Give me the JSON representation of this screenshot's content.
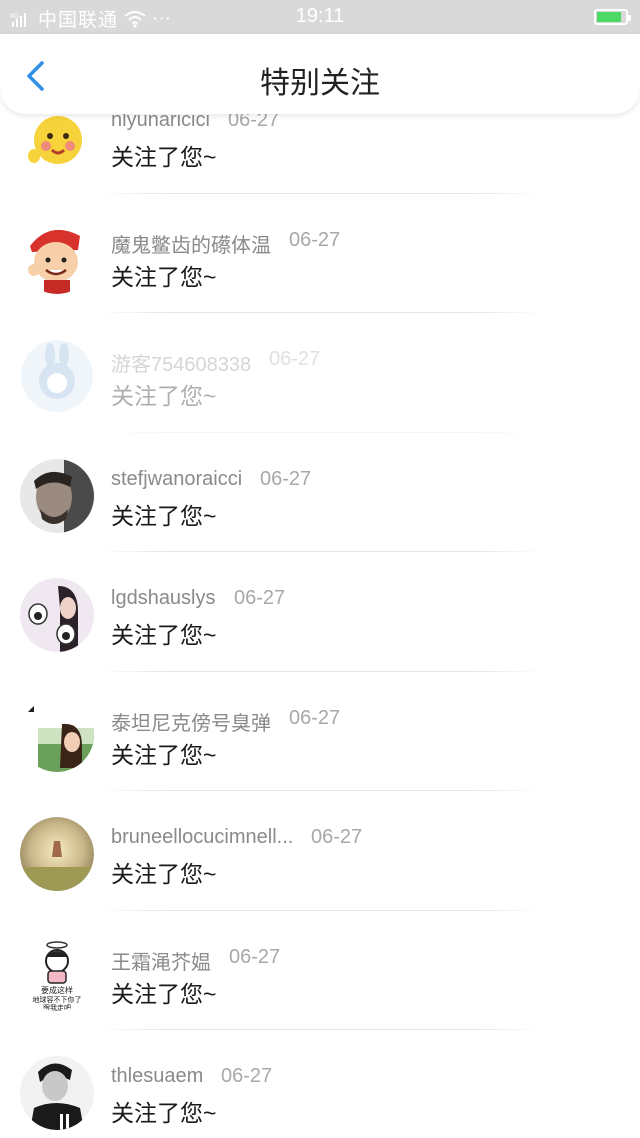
{
  "status_bar": {
    "carrier": "中国联通",
    "time": "19:11",
    "more": "···",
    "battery_level": 0.85
  },
  "header": {
    "title": "特别关注",
    "back_icon": "chevron-left-icon",
    "accent": "#2f8ee6"
  },
  "items": [
    {
      "name": "nlyunaricici",
      "date": "06-27",
      "message": "关注了您~",
      "avatar": "yellow-smiley-avatar"
    },
    {
      "name": "魔鬼鳖齿的礤体温",
      "date": "06-27",
      "message": "关注了您~",
      "avatar": "cartoon-boy-avatar"
    },
    {
      "name": "游客754608338",
      "date": "06-27",
      "message": "关注了您~",
      "avatar": "default-rabbit-avatar"
    },
    {
      "name": "stefjwanoraicci",
      "date": "06-27",
      "message": "关注了您~",
      "avatar": "man-portrait-avatar"
    },
    {
      "name": "lgdshauslys",
      "date": "06-27",
      "message": "关注了您~",
      "avatar": "girl-paws-avatar"
    },
    {
      "name": "泰坦尼克傍号臭弹",
      "date": "06-27",
      "message": "关注了您~",
      "avatar": "girl-outdoor-avatar"
    },
    {
      "name": "bruneellocucimnell...",
      "date": "06-27",
      "message": "关注了您~",
      "avatar": "sunset-hand-avatar"
    },
    {
      "name": "王霜渑芥媪",
      "date": "06-27",
      "message": "关注了您~",
      "avatar": "cartoon-angel-avatar"
    },
    {
      "name": "thlesuaem",
      "date": "06-27",
      "message": "关注了您~",
      "avatar": "man-bw-avatar"
    }
  ]
}
